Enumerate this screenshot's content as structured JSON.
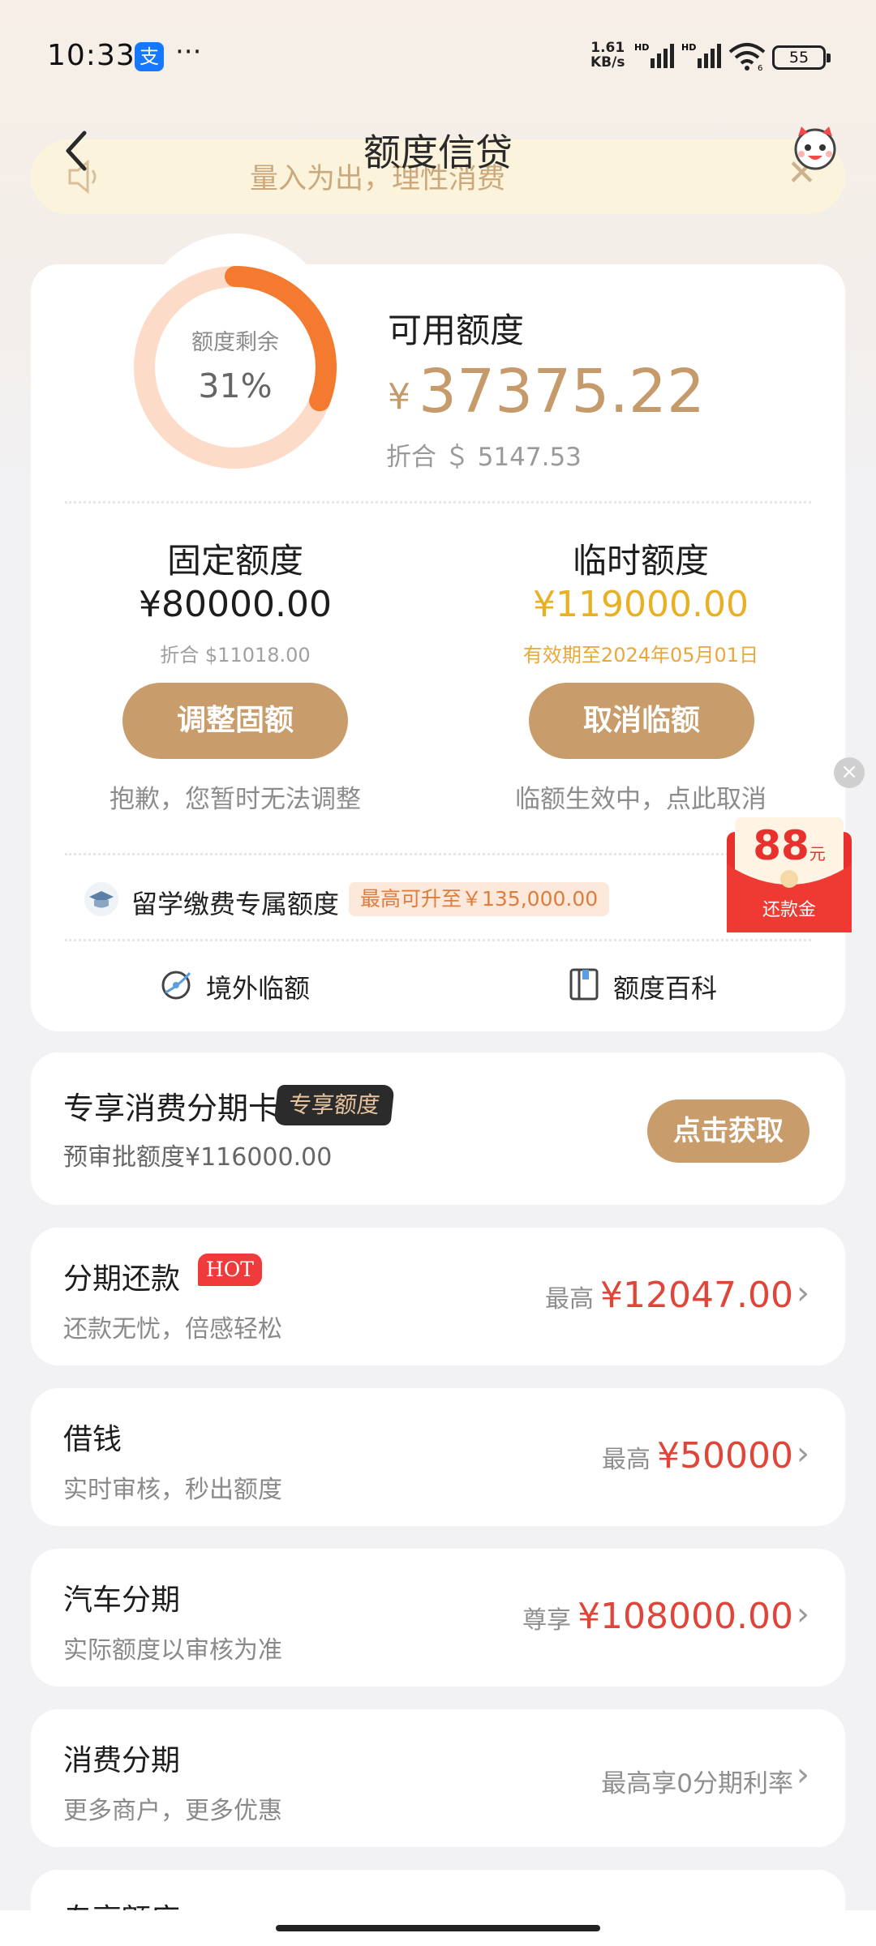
{
  "status_bar": {
    "time": "10:33",
    "app_badge": "支",
    "more": "···",
    "net_speed": "1.61",
    "net_unit": "KB/s",
    "hd1": "HD",
    "hd2": "HD",
    "wifi_sub": "6",
    "battery": "55"
  },
  "header": {
    "title": "额度信贷",
    "notice": "量入为出，理性消费"
  },
  "credit": {
    "ring_label": "额度剩余",
    "ring_percent": "31%",
    "ring_fraction": 0.31,
    "available_label": "可用额度",
    "currency": "¥",
    "available_amount": "37375.22",
    "available_usd": "折合 ＄ 5147.53",
    "fixed": {
      "title": "固定额度",
      "amount": "¥80000.00",
      "usd": "折合 $11018.00",
      "button": "调整固额",
      "note": "抱歉，您暂时无法调整"
    },
    "temporary": {
      "title": "临时额度",
      "amount": "¥119000.00",
      "validity": "有效期至2024年05月01日",
      "button": "取消临额",
      "note": "临额生效中，点此取消"
    },
    "study": {
      "label": "留学缴费专属额度",
      "badge": "最高可升至￥135,000.00"
    },
    "links": [
      {
        "label": "境外临额"
      },
      {
        "label": "额度百科"
      }
    ]
  },
  "promo": {
    "amount": "88",
    "unit": "元",
    "label": "还款金",
    "close": "×"
  },
  "exclusive_card": {
    "title": "专享消费分期卡",
    "badge": "专享额度",
    "sub": "预审批额度¥116000.00",
    "button": "点击获取"
  },
  "rows": [
    {
      "title": "分期还款",
      "tag": "HOT",
      "sub": "还款无忧，倍感轻松",
      "prefix": "最高",
      "amount": "¥12047.00"
    },
    {
      "title": "借钱",
      "sub": "实时审核，秒出额度",
      "prefix": "最高",
      "amount": "¥50000"
    },
    {
      "title": "汽车分期",
      "sub": "实际额度以审核为准",
      "prefix": "尊享",
      "amount": "¥108000.00"
    },
    {
      "title": "消费分期",
      "sub": "更多商户，更多优惠",
      "right_text": "最高享0分期利率"
    },
    {
      "title": "专享额度"
    }
  ],
  "colors": {
    "gold": "#c89c6b",
    "red": "#e0453a",
    "orange": "#f37a2f"
  }
}
